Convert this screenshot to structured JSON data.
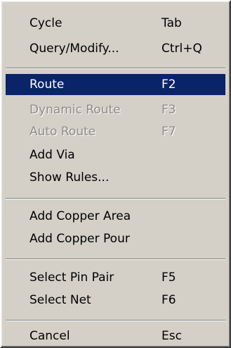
{
  "menu": {
    "colors": {
      "background": "#d4d0c8",
      "highlight": "#0a246a",
      "highlight_text": "#ffffff",
      "disabled_text": "#8f8c85"
    },
    "items": [
      {
        "label": "Cycle",
        "shortcut": "Tab",
        "state": "normal"
      },
      {
        "label": "Query/Modify...",
        "shortcut": "Ctrl+Q",
        "state": "normal"
      },
      {
        "label": "Route",
        "shortcut": "F2",
        "state": "highlighted"
      },
      {
        "label": "Dynamic Route",
        "shortcut": "F3",
        "state": "disabled"
      },
      {
        "label": "Auto Route",
        "shortcut": "F7",
        "state": "disabled"
      },
      {
        "label": "Add Via",
        "shortcut": "",
        "state": "normal"
      },
      {
        "label": "Show Rules...",
        "shortcut": "",
        "state": "normal"
      },
      {
        "label": "Add Copper Area",
        "shortcut": "",
        "state": "normal"
      },
      {
        "label": "Add Copper Pour",
        "shortcut": "",
        "state": "normal"
      },
      {
        "label": "Select Pin Pair",
        "shortcut": "F5",
        "state": "normal"
      },
      {
        "label": "Select Net",
        "shortcut": "F6",
        "state": "normal"
      },
      {
        "label": "Cancel",
        "shortcut": "Esc",
        "state": "normal"
      }
    ]
  }
}
